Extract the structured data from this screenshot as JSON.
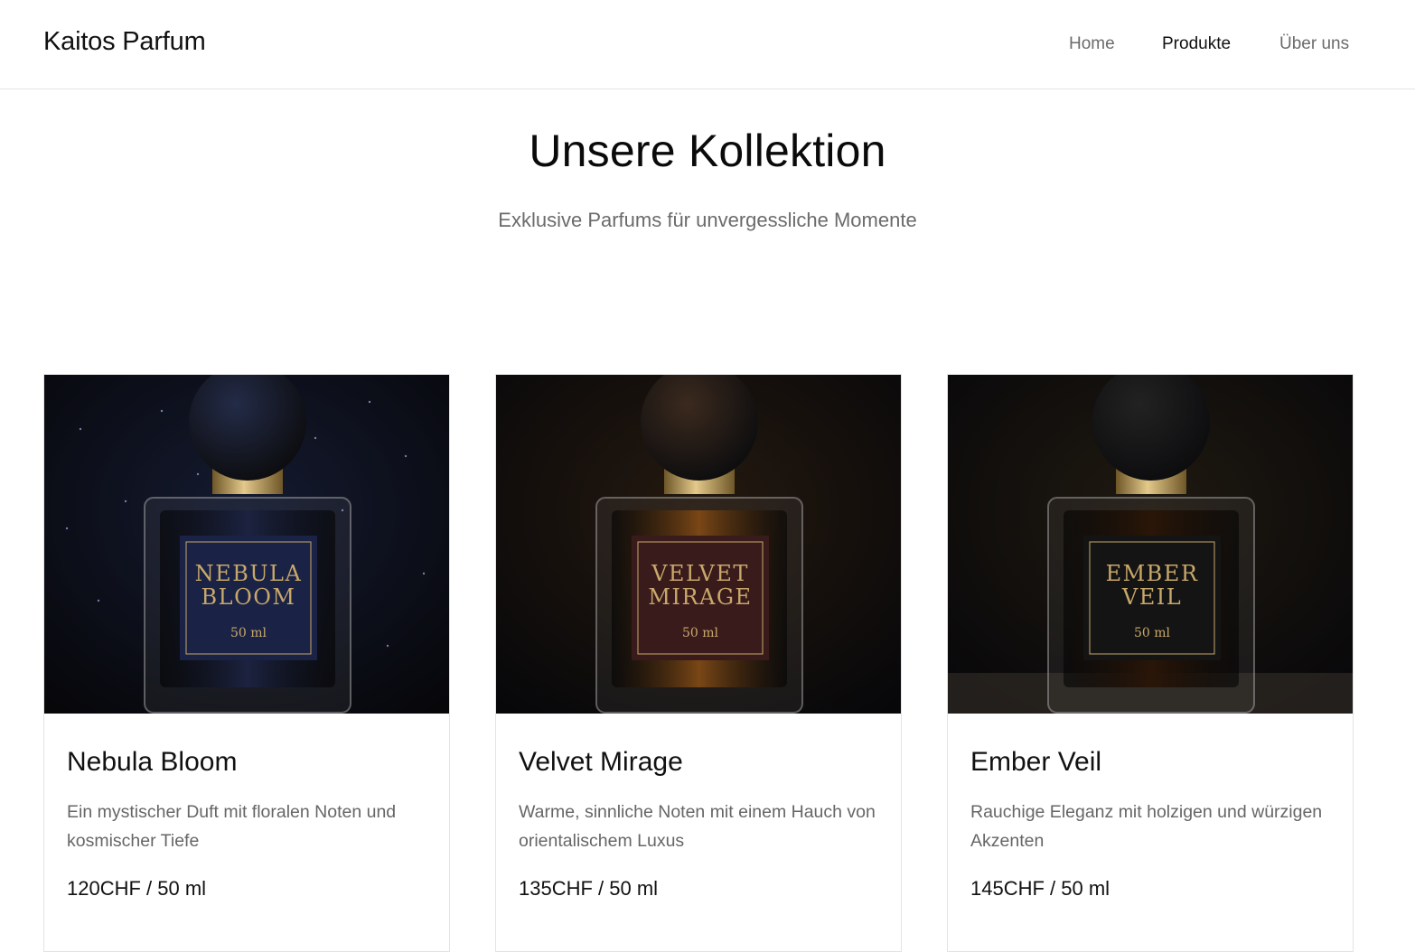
{
  "brand": "Kaitos Parfum",
  "nav": [
    {
      "label": "Home",
      "active": false
    },
    {
      "label": "Produkte",
      "active": true
    },
    {
      "label": "Über uns",
      "active": false
    }
  ],
  "hero": {
    "title": "Unsere Kollektion",
    "subtitle": "Exklusive Parfums für unvergessliche Momente"
  },
  "products": [
    {
      "name": "Nebula Bloom",
      "description": "Ein mystischer Duft mit floralen Noten und kosmischer Tiefe",
      "price": "120CHF / 50 ml",
      "label_line1": "NEBULA",
      "label_line2": "BLOOM",
      "label_volume": "50 ml",
      "colors": {
        "bg": "#141a30",
        "cap": "#232b47",
        "liquid": "#1c2340",
        "label": "#1a2246",
        "gold": "#c8a86a"
      }
    },
    {
      "name": "Velvet Mirage",
      "description": "Warme, sinnliche Noten mit einem Hauch von orientalischem Luxus",
      "price": "135CHF / 50 ml",
      "label_line1": "VELVET",
      "label_line2": "MIRAGE",
      "label_volume": "50 ml",
      "colors": {
        "bg": "#24190f",
        "cap": "#3b2a1e",
        "liquid": "#7a4716",
        "label": "#3a1b1c",
        "gold": "#c8a86a"
      }
    },
    {
      "name": "Ember Veil",
      "description": "Rauchige Eleganz mit holzigen und würzigen Akzenten",
      "price": "145CHF / 50 ml",
      "label_line1": "EMBER",
      "label_line2": "VEIL",
      "label_volume": "50 ml",
      "colors": {
        "bg": "#1f1910",
        "cap": "#222222",
        "liquid": "#2a1608",
        "label": "#141414",
        "gold": "#c8a86a"
      }
    }
  ]
}
